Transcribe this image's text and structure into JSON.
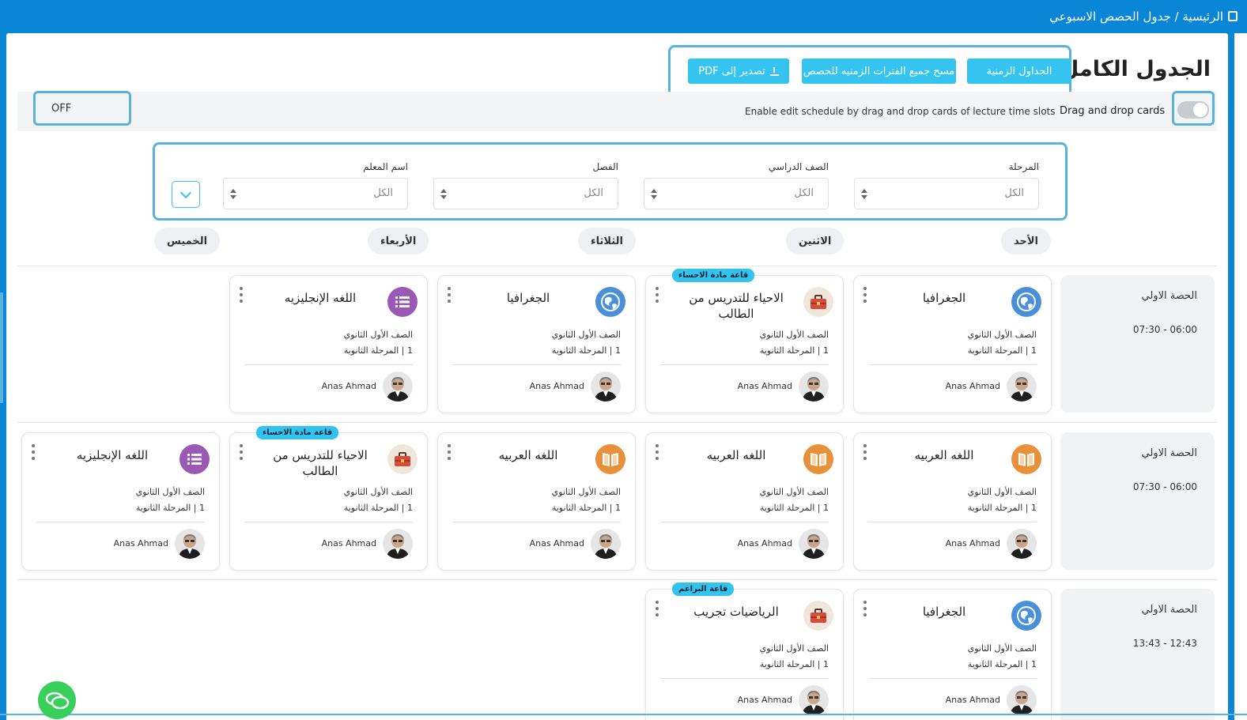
{
  "breadcrumb": {
    "text": "الرئيسية / جدول الحصص الاسبوعي",
    "icon": "calendar-icon"
  },
  "page": {
    "title": "الجدول الكامل"
  },
  "toolbar": {
    "timetables_label": "الجداول الزمنية",
    "clear_all_label": "مسح جميع الفترات الزمنيه للحصص",
    "export_pdf_label": "تصدير إلى PDF"
  },
  "dnd": {
    "title": "Drag and drop cards",
    "description": "Enable edit schedule by drag and drop cards of lecture time slots",
    "state_label": "OFF",
    "enabled": false
  },
  "filters": {
    "stage": {
      "label": "المرحلة",
      "value": "الكل"
    },
    "grade": {
      "label": "الصف الدراسي",
      "value": "الكل"
    },
    "class": {
      "label": "الفصل",
      "value": "الكل"
    },
    "teacher": {
      "label": "اسم المعلم",
      "value": "الكل"
    }
  },
  "days": [
    "الأحد",
    "الاثنين",
    "الثلاثاء",
    "الأربعاء",
    "الخميس"
  ],
  "colors": {
    "primary": "#0a86d6",
    "accent": "#35c3f0",
    "geo": "#4a90d9",
    "arabic": "#e8913a",
    "english": "#9b59b6",
    "biology": "#d84a3b"
  },
  "rows": [
    {
      "period": "الحصة الاولي",
      "time": "07:30 - 06:00",
      "cards": [
        {
          "subject": "الجغرافيا",
          "icon": "globe-icon",
          "grade": "الصف الأول الثانوي",
          "stage": "1 | المرحلة الثانوية",
          "teacher": "Anas Ahmad",
          "room": ""
        },
        {
          "subject": "الاحياء للتدريس من الطالب",
          "icon": "briefcase-icon",
          "grade": "الصف الأول الثانوي",
          "stage": "1 | المرحلة الثانوية",
          "teacher": "Anas Ahmad",
          "room": "قاعة مادة الاحساء"
        },
        {
          "subject": "الجغرافيا",
          "icon": "globe-icon",
          "grade": "الصف الأول الثانوي",
          "stage": "1 | المرحلة الثانوية",
          "teacher": "Anas Ahmad",
          "room": ""
        },
        {
          "subject": "اللغه الإنجليزيه",
          "icon": "list-icon",
          "grade": "الصف الأول الثانوي",
          "stage": "1 | المرحلة الثانوية",
          "teacher": "Anas Ahmad",
          "room": ""
        }
      ]
    },
    {
      "period": "الحصة الاولي",
      "time": "07:30 - 06:00",
      "cards": [
        {
          "subject": "اللغه العربيه",
          "icon": "book-icon",
          "grade": "الصف الأول الثانوي",
          "stage": "1 | المرحلة الثانوية",
          "teacher": "Anas Ahmad",
          "room": ""
        },
        {
          "subject": "اللغه العربيه",
          "icon": "book-icon",
          "grade": "الصف الأول الثانوي",
          "stage": "1 | المرحلة الثانوية",
          "teacher": "Anas Ahmad",
          "room": ""
        },
        {
          "subject": "اللغه العربيه",
          "icon": "book-icon",
          "grade": "الصف الأول الثانوي",
          "stage": "1 | المرحلة الثانوية",
          "teacher": "Anas Ahmad",
          "room": ""
        },
        {
          "subject": "الاحياء للتدريس من الطالب",
          "icon": "briefcase-icon",
          "grade": "الصف الأول الثانوي",
          "stage": "1 | المرحلة الثانوية",
          "teacher": "Anas Ahmad",
          "room": "قاعة مادة الاحساء"
        },
        {
          "subject": "اللغه الإنجليزيه",
          "icon": "list-icon",
          "grade": "الصف الأول الثانوي",
          "stage": "1 | المرحلة الثانوية",
          "teacher": "Anas Ahmad",
          "room": ""
        }
      ]
    },
    {
      "period": "الحصة الاولي",
      "time": "13:43 - 12:43",
      "cards": [
        {
          "subject": "الجغرافيا",
          "icon": "globe-icon",
          "grade": "الصف الأول الثانوي",
          "stage": "1 | المرحلة الثانوية",
          "teacher": "Anas Ahmad",
          "room": ""
        },
        {
          "subject": "الرياضيات تجريب",
          "icon": "briefcase-icon",
          "grade": "الصف الأول الثانوي",
          "stage": "1 | المرحلة الثانوية",
          "teacher": "Anas Ahmad",
          "room": "قاعة البراعم"
        }
      ]
    }
  ]
}
